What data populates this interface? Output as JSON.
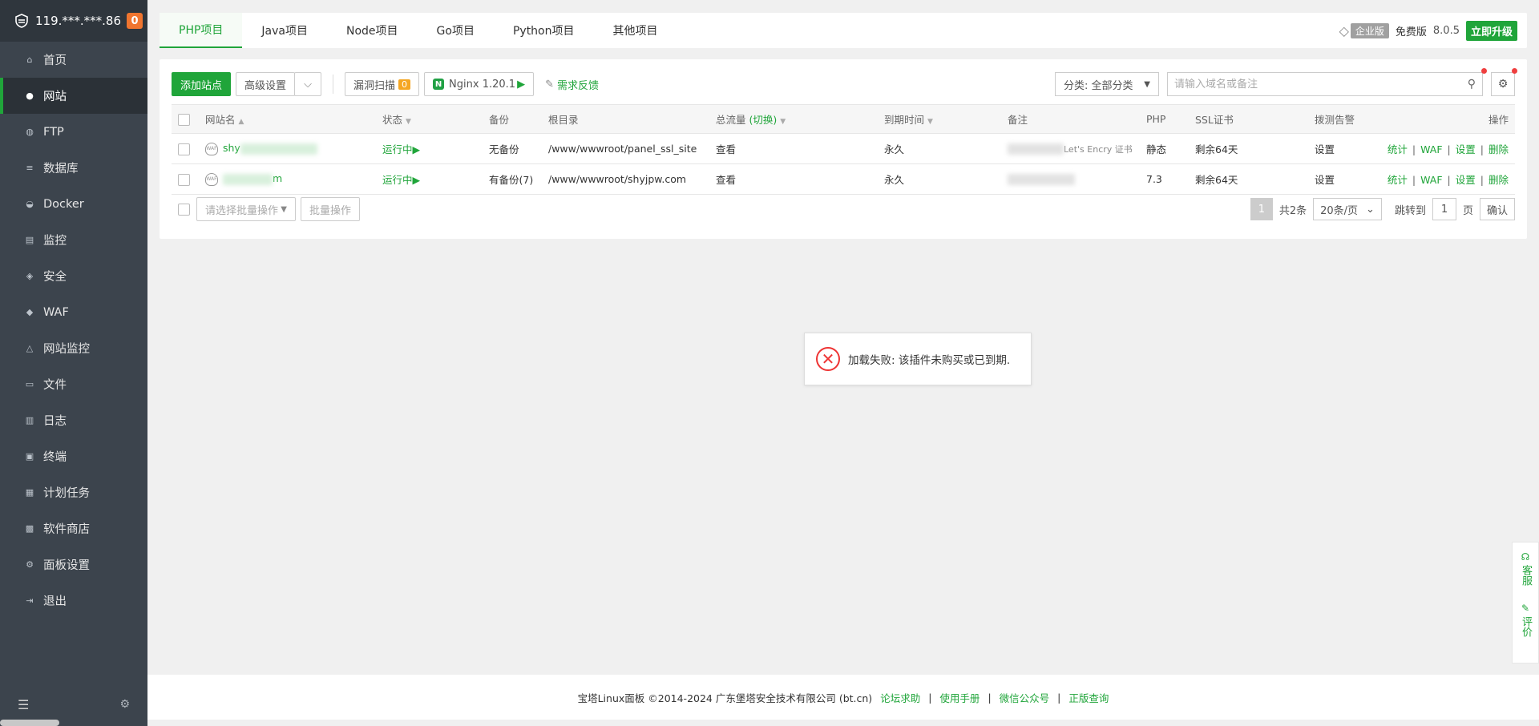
{
  "server": {
    "ip": "119.***.***.86",
    "badge": "0"
  },
  "menu": [
    {
      "label": "首页",
      "icon": "home-icon"
    },
    {
      "label": "网站",
      "icon": "globe-icon"
    },
    {
      "label": "FTP",
      "icon": "ftp-icon"
    },
    {
      "label": "数据库",
      "icon": "database-icon"
    },
    {
      "label": "Docker",
      "icon": "docker-icon"
    },
    {
      "label": "监控",
      "icon": "monitor-icon"
    },
    {
      "label": "安全",
      "icon": "shield-icon"
    },
    {
      "label": "WAF",
      "icon": "waf-icon"
    },
    {
      "label": "网站监控",
      "icon": "chart-icon"
    },
    {
      "label": "文件",
      "icon": "folder-icon"
    },
    {
      "label": "日志",
      "icon": "log-icon"
    },
    {
      "label": "终端",
      "icon": "terminal-icon"
    },
    {
      "label": "计划任务",
      "icon": "task-icon"
    },
    {
      "label": "软件商店",
      "icon": "store-icon"
    },
    {
      "label": "面板设置",
      "icon": "settings-icon"
    },
    {
      "label": "退出",
      "icon": "logout-icon"
    }
  ],
  "tabs": [
    "PHP项目",
    "Java项目",
    "Node项目",
    "Go项目",
    "Python项目",
    "其他项目"
  ],
  "topright": {
    "enterprise": "企业版",
    "free": "免费版",
    "version": "8.0.5",
    "upgrade": "立即升级"
  },
  "toolbar": {
    "add_site": "添加站点",
    "advanced": "高级设置",
    "vuln_scan": "漏洞扫描",
    "vuln_count": "0",
    "nginx": "Nginx 1.20.1",
    "feedback": "需求反馈",
    "category": "分类: 全部分类",
    "search_placeholder": "请输入域名或备注"
  },
  "table": {
    "headers": [
      "网站名",
      "状态",
      "备份",
      "根目录",
      "总流量",
      "(切换)",
      "到期时间",
      "备注",
      "PHP",
      "SSL证书",
      "拨测告警",
      "操作"
    ],
    "rows": [
      {
        "name": "shy",
        "status": "运行中",
        "backup": "无备份",
        "root": "/www/wwwroot/panel_ssl_site",
        "traffic": "查看",
        "expire": "永久",
        "remark": "Let's Encry 证书",
        "php": "静态",
        "ssl": "剩余64天",
        "alarm": "设置",
        "ops": [
          "统计",
          "WAF",
          "设置",
          "删除"
        ]
      },
      {
        "name": "m",
        "status": "运行中",
        "backup": "有备份(7)",
        "root": "/www/wwwroot/shyjpw.com",
        "traffic": "查看",
        "expire": "永久",
        "remark": "",
        "php": "7.3",
        "ssl": "剩余64天",
        "alarm": "设置",
        "ops": [
          "统计",
          "WAF",
          "设置",
          "删除"
        ]
      }
    ]
  },
  "pager": {
    "batch_placeholder": "请选择批量操作",
    "batch_btn": "批量操作",
    "current": "1",
    "total": "共2条",
    "per_page": "20条/页",
    "jump": "跳转到",
    "jump_val": "1",
    "page": "页",
    "confirm": "确认"
  },
  "toast": {
    "message": "加载失败: 该插件未购买或已到期."
  },
  "float": {
    "service": "客服",
    "rate": "评价"
  },
  "footer": {
    "copyright": "宝塔Linux面板 ©2014-2024 广东堡塔安全技术有限公司 (bt.cn)",
    "links": [
      "论坛求助",
      "使用手册",
      "微信公众号",
      "正版查询"
    ]
  }
}
